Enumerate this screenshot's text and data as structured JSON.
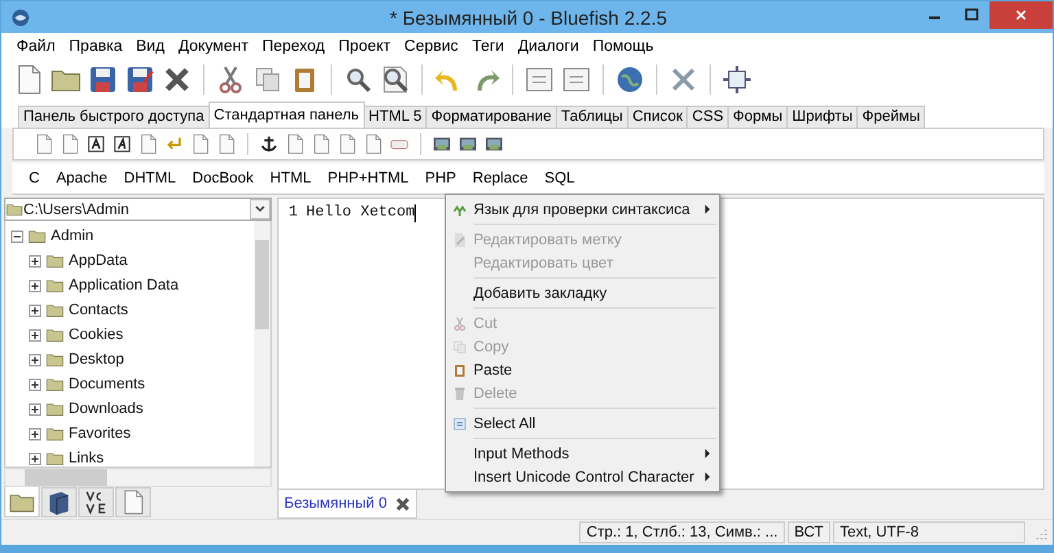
{
  "window": {
    "title": "* Безымянный 0 - Bluefish 2.2.5"
  },
  "menu": [
    "Файл",
    "Правка",
    "Вид",
    "Документ",
    "Переход",
    "Проект",
    "Сервис",
    "Теги",
    "Диалоги",
    "Помощь"
  ],
  "toolbar_tabs": [
    {
      "label": "Панель быстрого доступа",
      "selected": false
    },
    {
      "label": "Стандартная панель",
      "selected": true
    },
    {
      "label": "HTML 5",
      "selected": false
    },
    {
      "label": "Форматирование",
      "selected": false
    },
    {
      "label": "Таблицы",
      "selected": false
    },
    {
      "label": "Список",
      "selected": false
    },
    {
      "label": "CSS",
      "selected": false
    },
    {
      "label": "Формы",
      "selected": false
    },
    {
      "label": "Шрифты",
      "selected": false
    },
    {
      "label": "Фреймы",
      "selected": false
    }
  ],
  "filetypes": [
    "C",
    "Apache",
    "DHTML",
    "DocBook",
    "HTML",
    "PHP+HTML",
    "PHP",
    "Replace",
    "SQL"
  ],
  "sidebar": {
    "path": "C:\\Users\\Admin",
    "tree": [
      {
        "label": "Admin",
        "expanded": true,
        "children": [
          {
            "label": "AppData",
            "expanded": false
          },
          {
            "label": "Application Data",
            "expanded": false
          },
          {
            "label": "Contacts",
            "expanded": false
          },
          {
            "label": "Cookies",
            "expanded": false
          },
          {
            "label": "Desktop",
            "expanded": false
          },
          {
            "label": "Documents",
            "expanded": false
          },
          {
            "label": "Downloads",
            "expanded": false
          },
          {
            "label": "Favorites",
            "expanded": false
          },
          {
            "label": "Links",
            "expanded": false
          }
        ]
      }
    ],
    "tabs": [
      {
        "selected": true
      },
      {
        "selected": false
      },
      {
        "selected": false
      },
      {
        "selected": false
      }
    ]
  },
  "editor": {
    "lines": [
      {
        "number": "1",
        "text": "Hello Xetcom"
      }
    ],
    "tab": {
      "label": "Безымянный 0",
      "selected": true
    }
  },
  "context_menu": [
    {
      "kind": "item",
      "label": "Язык для проверки синтаксиса",
      "disabled": false,
      "submenu": true
    },
    {
      "kind": "separator"
    },
    {
      "kind": "item",
      "label": "Редактировать метку",
      "disabled": true,
      "submenu": false
    },
    {
      "kind": "item",
      "label": "Редактировать цвет",
      "disabled": true,
      "submenu": false
    },
    {
      "kind": "separator"
    },
    {
      "kind": "item",
      "label": "Добавить закладку",
      "disabled": false,
      "submenu": false
    },
    {
      "kind": "separator"
    },
    {
      "kind": "item",
      "label": "Cut",
      "disabled": true,
      "submenu": false
    },
    {
      "kind": "item",
      "label": "Copy",
      "disabled": true,
      "submenu": false
    },
    {
      "kind": "item",
      "label": "Paste",
      "disabled": false,
      "submenu": false
    },
    {
      "kind": "item",
      "label": "Delete",
      "disabled": true,
      "submenu": false
    },
    {
      "kind": "separator"
    },
    {
      "kind": "item",
      "label": "Select All",
      "disabled": false,
      "submenu": false
    },
    {
      "kind": "separator"
    },
    {
      "kind": "item",
      "label": "Input Methods",
      "disabled": false,
      "submenu": true
    },
    {
      "kind": "item",
      "label": "Insert Unicode Control Character",
      "disabled": false,
      "submenu": true
    }
  ],
  "status_bar": [
    "Стр.: 1, Стлб.: 13, Симв.: ...",
    "ВСТ",
    "Text, UTF-8"
  ]
}
